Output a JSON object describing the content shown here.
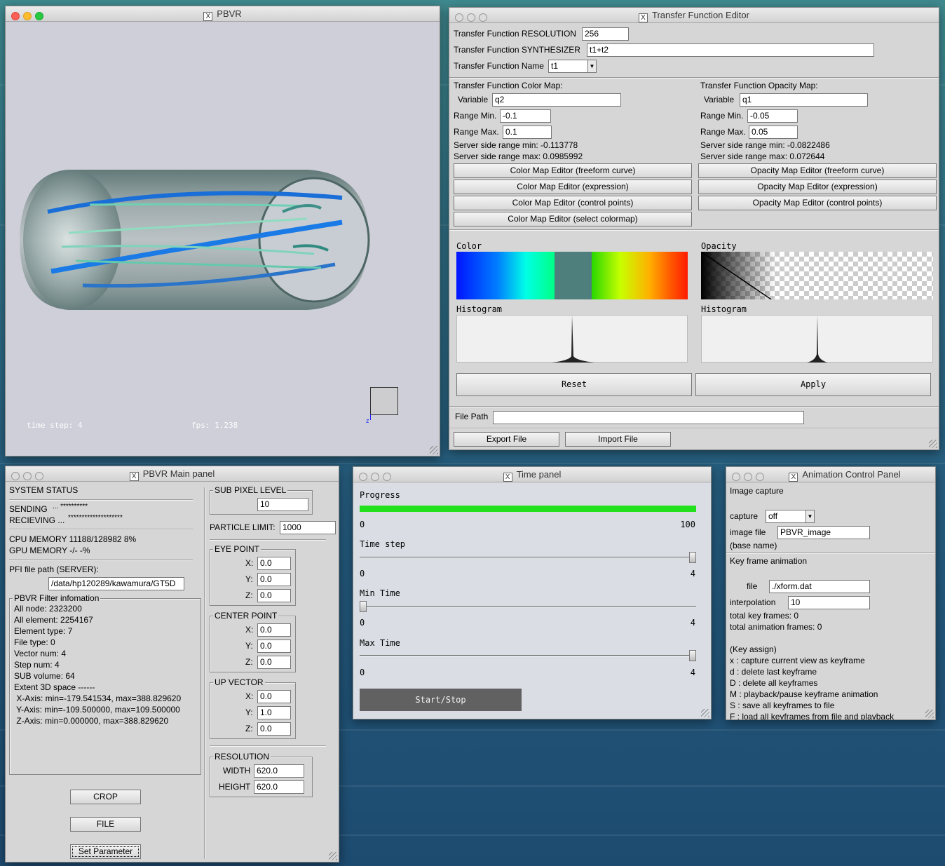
{
  "pbvr_window": {
    "title": "PBVR",
    "time_step": "time step: 4",
    "fps": "fps: 1.238",
    "axis_label": "z"
  },
  "tf_editor": {
    "title": "Transfer Function Editor",
    "resolution_label": "Transfer Function RESOLUTION",
    "resolution_value": "256",
    "synth_label": "Transfer Function SYNTHESIZER",
    "synth_value": "t1+t2",
    "name_label": "Transfer Function Name",
    "name_value": "t1",
    "color_map": {
      "heading": "Transfer Function Color Map:",
      "variable_label": "Variable",
      "variable_value": "q2",
      "range_min_label": "Range Min.",
      "range_min_value": "-0.1",
      "range_max_label": "Range Max.",
      "range_max_value": "0.1",
      "server_min": "Server side range min: -0.113778",
      "server_max": "Server side range max: 0.0985992",
      "btn_freeform": "Color Map Editor (freeform curve)",
      "btn_expression": "Color Map Editor (expression)",
      "btn_control": "Color Map Editor (control points)",
      "btn_select": "Color Map Editor (select colormap)"
    },
    "opacity_map": {
      "heading": "Transfer Function Opacity Map:",
      "variable_label": "Variable",
      "variable_value": "q1",
      "range_min_label": "Range Min.",
      "range_min_value": "-0.05",
      "range_max_label": "Range Max.",
      "range_max_value": "0.05",
      "server_min": "Server side range min: -0.0822486",
      "server_max": "Server side range max: 0.072644",
      "btn_freeform": "Opacity Map Editor (freeform curve)",
      "btn_expression": "Opacity Map Editor (expression)",
      "btn_control": "Opacity Map Editor (control points)"
    },
    "color_label": "Color",
    "opacity_label": "Opacity",
    "histogram_label": "Histogram",
    "reset_label": "Reset",
    "apply_label": "Apply",
    "file_path_label": "File Path",
    "file_path_value": "",
    "export_label": "Export File",
    "import_label": "Import File"
  },
  "main_panel": {
    "title": "PBVR Main panel",
    "system_status": "SYSTEM STATUS",
    "sending_label": "SENDING",
    "sending_value": "...  **********",
    "receiving_label": "RECIEVING ...",
    "receiving_value": "********************",
    "cpu_memory": "CPU MEMORY 11188/128982 8%",
    "gpu_memory": "GPU MEMORY -/- -%",
    "pfi_label": "PFI file path (SERVER):",
    "pfi_value": "/data/hp120289/kawamura/GT5D",
    "filter_title": "PBVR Filter infomation",
    "filter_lines": [
      "All node: 2323200",
      "All element: 2254167",
      "Element type: 7",
      "File type: 0",
      "Vector num: 4",
      "Step num: 4",
      "SUB volume: 64",
      "Extent 3D space ------",
      " X-Axis: min=-179.541534, max=388.829620",
      " Y-Axis: min=-109.500000, max=109.500000",
      " Z-Axis: min=0.000000, max=388.829620"
    ],
    "crop_label": "CROP",
    "file_label": "FILE",
    "set_param_label": "Set Parameter",
    "sub_pixel_label": "SUB PIXEL LEVEL",
    "sub_pixel_value": "10",
    "particle_limit_label": "PARTICLE LIMIT:",
    "particle_limit_value": "1000",
    "eye_point_label": "EYE POINT",
    "eye_x": "0.0",
    "eye_y": "0.0",
    "eye_z": "0.0",
    "center_point_label": "CENTER POINT",
    "center_x": "0.0",
    "center_y": "0.0",
    "center_z": "0.0",
    "up_vector_label": "UP VECTOR",
    "up_x": "0.0",
    "up_y": "1.0",
    "up_z": "0.0",
    "x_label": "X:",
    "y_label": "Y:",
    "z_label": "Z:",
    "resolution_label": "RESOLUTION",
    "width_label": "WIDTH",
    "width_value": "620.0",
    "height_label": "HEIGHT",
    "height_value": "620.0"
  },
  "time_panel": {
    "title": "Time panel",
    "progress_label": "Progress",
    "progress_min": "0",
    "progress_max": "100",
    "progress_fraction": 1.0,
    "time_step_label": "Time step",
    "time_step_min": "0",
    "time_step_max": "4",
    "time_step_value": 4,
    "min_time_label": "Min Time",
    "min_time_min": "0",
    "min_time_max": "4",
    "min_time_value": 0,
    "max_time_label": "Max Time",
    "max_time_min": "0",
    "max_time_max": "4",
    "max_time_value": 4,
    "start_stop_label": "Start/Stop"
  },
  "anim_panel": {
    "title": "Animation Control Panel",
    "image_capture_label": "Image capture",
    "capture_label": "capture",
    "capture_value": "off",
    "image_file_label": "image file",
    "image_file_value": "PBVR_image",
    "base_name_label": "(base name)",
    "key_frame_label": "Key frame animation",
    "file_label": "file",
    "file_value": "./xform.dat",
    "interpolation_label": "interpolation",
    "interpolation_value": "10",
    "total_key_frames": "total key frames: 0",
    "total_anim_frames": "total animation frames: 0",
    "key_assign_label": "(Key assign)",
    "key_lines": [
      "x : capture current view as keyframe",
      "d : delete last keyframe",
      "D : delete all keyframes",
      "M : playback/pause keyframe animation",
      "S : save all keyframes to file",
      "F : load all keyframes from file and playback"
    ]
  },
  "colors": {
    "progress_green": "#22e01c",
    "start_button": "#616161",
    "desktop": "#2f6f86"
  }
}
